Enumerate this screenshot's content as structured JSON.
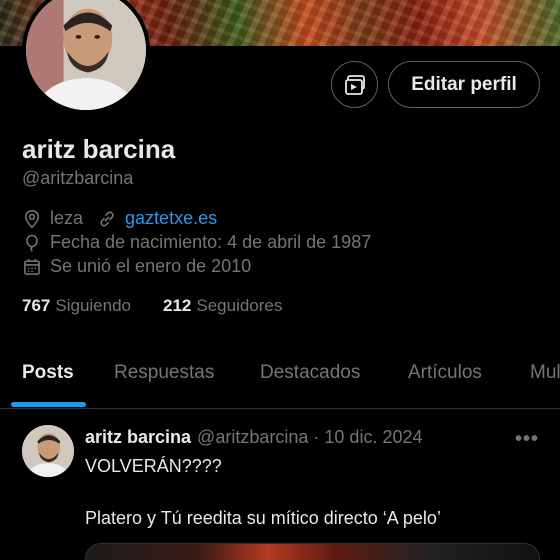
{
  "profile": {
    "name": "aritz barcina",
    "handle": "@aritzbarcina",
    "location": "leza",
    "website": "gaztetxe.es",
    "birthday": "Fecha de nacimiento: 4 de abril de 1987",
    "joined": "Se unió el enero de 2010",
    "following_count": "767",
    "following_label": "Siguiendo",
    "followers_count": "212",
    "followers_label": "Seguidores"
  },
  "actions": {
    "edit_label": "Editar perfil",
    "media_icon": "media-icon"
  },
  "tabs": [
    {
      "label": "Posts",
      "active": true
    },
    {
      "label": "Respuestas"
    },
    {
      "label": "Destacados"
    },
    {
      "label": "Artículos"
    },
    {
      "label": "Mul"
    }
  ],
  "post": {
    "author": "aritz barcina",
    "handle": "@aritzbarcina",
    "separator": "·",
    "date": "10 dic. 2024",
    "more": "•••",
    "text_line1": "VOLVERÁN????",
    "text_line2": "Platero y Tú reedita su mítico directo ‘A pelo’"
  },
  "colors": {
    "accent": "#1d9bf0",
    "background": "#000000",
    "muted": "#71767b"
  }
}
